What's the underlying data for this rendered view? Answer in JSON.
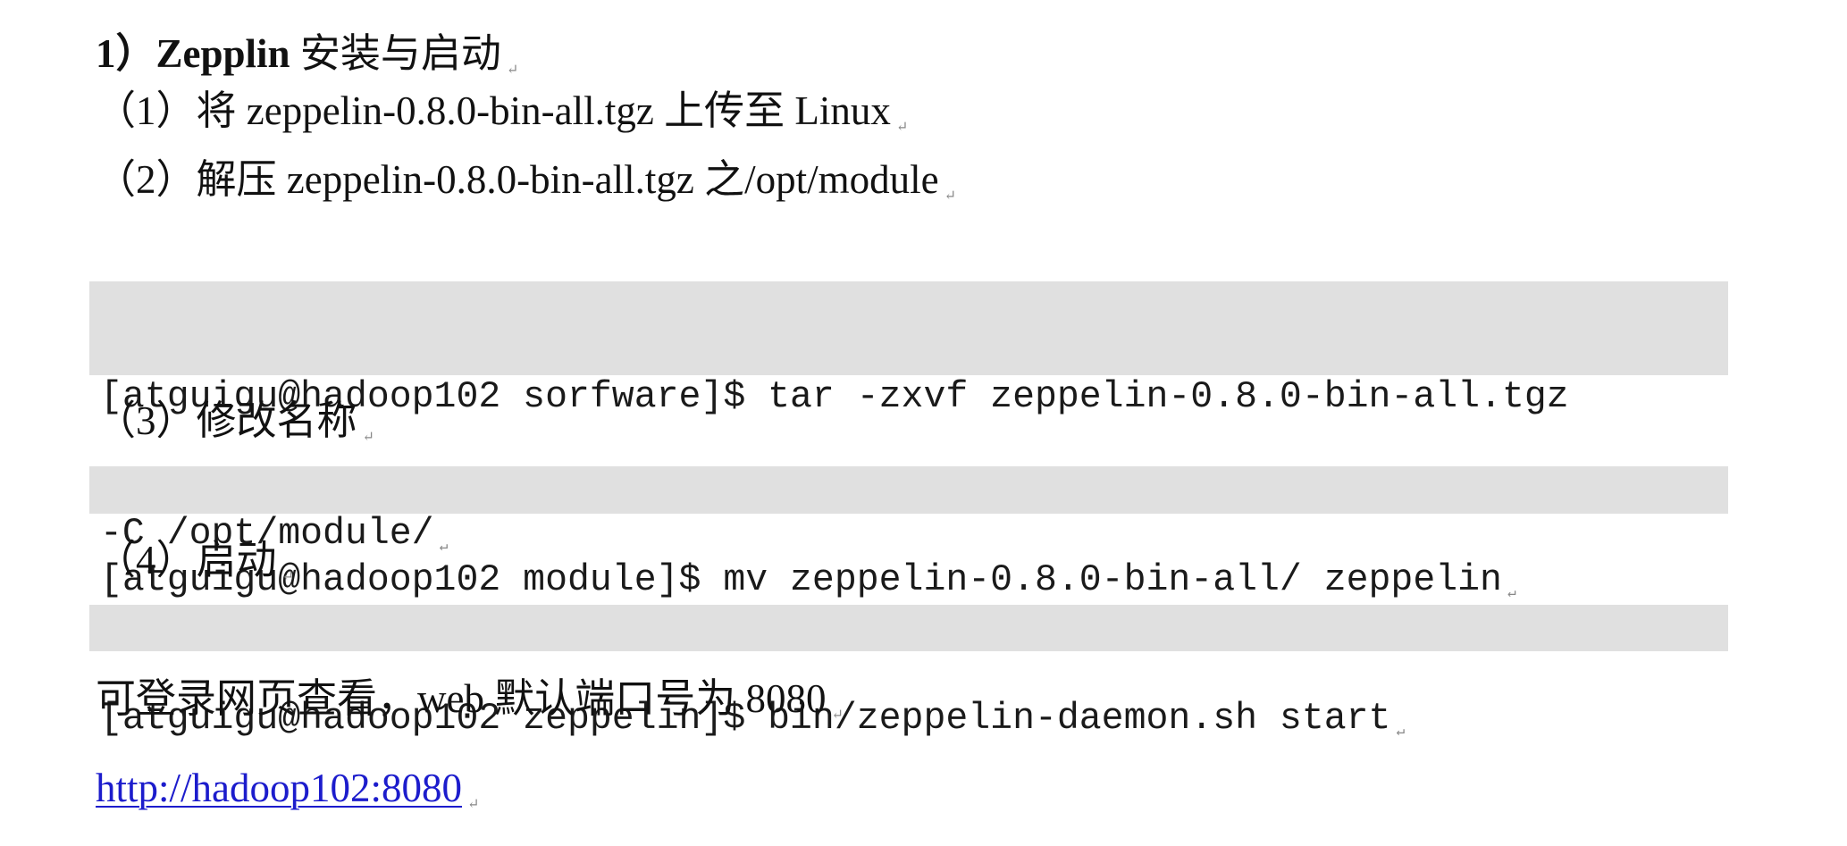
{
  "heading": {
    "number": "1）",
    "title_bold": "Zepplin",
    "title_rest": " 安装与启动"
  },
  "steps": [
    {
      "text": "（1）将 zeppelin-0.8.0-bin-all.tgz 上传至 Linux"
    },
    {
      "text": "（2）解压 zeppelin-0.8.0-bin-all.tgz 之/opt/module"
    },
    {
      "text": "（3）修改名称"
    },
    {
      "text": "（4）启动"
    }
  ],
  "code_blocks": [
    {
      "line1": "[atguigu@hadoop102 sorfware]$ tar -zxvf zeppelin-0.8.0-bin-all.tgz",
      "line2": "-C /opt/module/"
    },
    {
      "line1": "[atguigu@hadoop102 module]$ mv zeppelin-0.8.0-bin-all/ zeppelin"
    },
    {
      "line1": "[atguigu@hadoop102 zeppelin]$ bin/zeppelin-daemon.sh start"
    }
  ],
  "note": "可登录网页查看，web 默认端口号为 8080",
  "link": {
    "text": "http://hadoop102:8080"
  },
  "paragraph_mark": "↵",
  "colors": {
    "code_background": "#e0e0e0",
    "link": "#1c1ccc"
  }
}
